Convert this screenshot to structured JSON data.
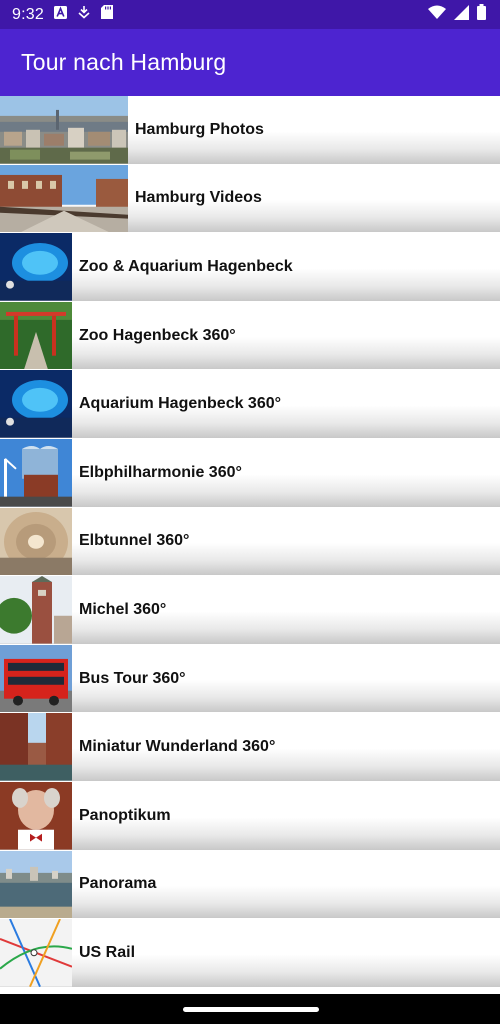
{
  "status_bar": {
    "time": "9:32",
    "icons": [
      "a-box-icon",
      "download-icon",
      "sd-card-icon",
      "wifi-icon",
      "signal-icon",
      "battery-icon"
    ]
  },
  "app_bar": {
    "title": "Tour nach Hamburg"
  },
  "list": {
    "items": [
      {
        "label": "Hamburg Photos",
        "thumbnail": "hamburg-skyline-photo"
      },
      {
        "label": "Hamburg Videos",
        "thumbnail": "bridge-warehouse-photo"
      },
      {
        "label": "Zoo & Aquarium Hagenbeck",
        "thumbnail": "aquarium-photo"
      },
      {
        "label": "Zoo Hagenbeck 360°",
        "thumbnail": "zoo-gate-photo"
      },
      {
        "label": "Aquarium Hagenbeck 360°",
        "thumbnail": "aquarium-360-photo"
      },
      {
        "label": "Elbphilharmonie 360°",
        "thumbnail": "elbphilharmonie-photo"
      },
      {
        "label": "Elbtunnel 360°",
        "thumbnail": "elbtunnel-photo"
      },
      {
        "label": "Michel 360°",
        "thumbnail": "michel-church-photo"
      },
      {
        "label": "Bus Tour 360°",
        "thumbnail": "red-bus-photo"
      },
      {
        "label": "Miniatur Wunderland 360°",
        "thumbnail": "speicherstadt-canal-photo"
      },
      {
        "label": "Panoptikum",
        "thumbnail": "wax-figure-photo"
      },
      {
        "label": "Panorama",
        "thumbnail": "harbor-panorama-photo"
      },
      {
        "label": "US Rail",
        "thumbnail": "rail-map-photo"
      }
    ]
  },
  "colors": {
    "status_bar": "#3f17a8",
    "app_bar": "#4d24d0",
    "row_gradient_end": "#c8c8c8",
    "label_text": "#111111"
  }
}
